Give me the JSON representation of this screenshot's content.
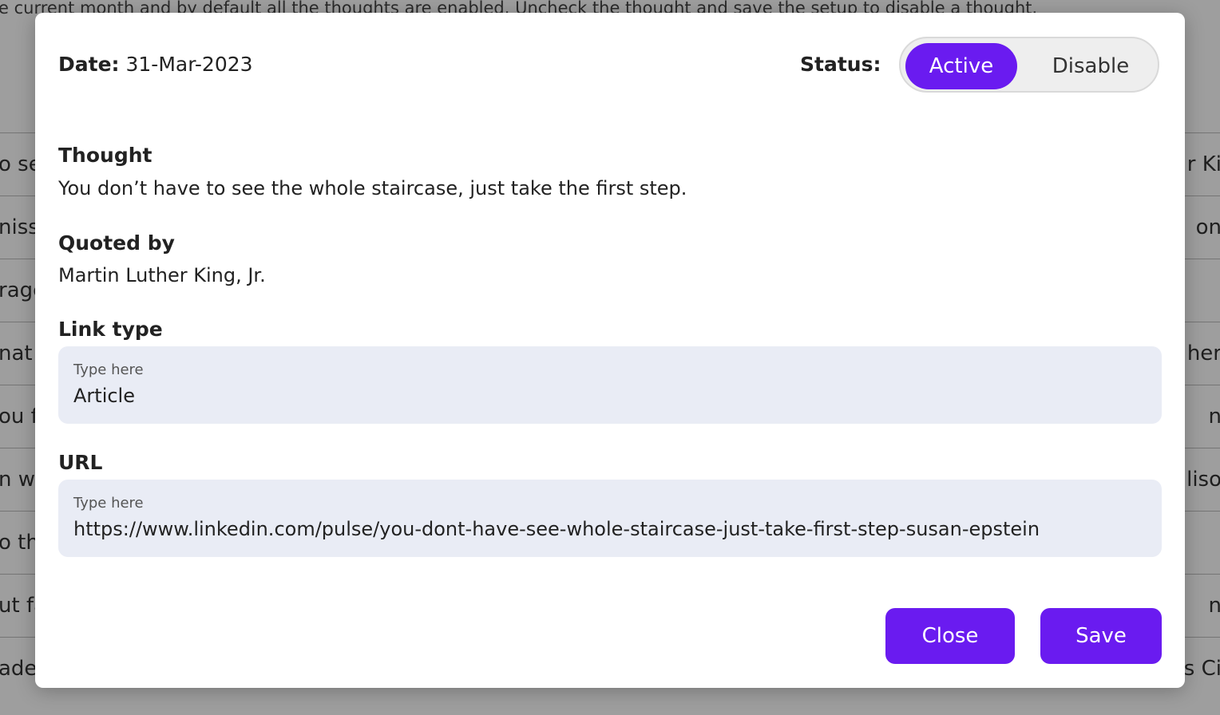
{
  "background": {
    "intro_text": "e current month and by default all the thoughts are enabled. Uncheck the thought and save the setup to disable a thought.",
    "rows": [
      {
        "left": "o se",
        "right": "r Ki"
      },
      {
        "left": "niss",
        "right": "on"
      },
      {
        "left": "rage",
        "right": ""
      },
      {
        "left": "nat l",
        "right": "her"
      },
      {
        "left": "ou f",
        "right": "n"
      },
      {
        "left": "n wa",
        "right": "liso"
      },
      {
        "left": "o th",
        "right": ""
      },
      {
        "left": "ut fa",
        "right": "n"
      },
      {
        "left": "ade",
        "right": "s Ci"
      }
    ]
  },
  "modal": {
    "date_label": "Date:",
    "date_value": "31-Mar-2023",
    "status_label": "Status:",
    "status_options": {
      "active": "Active",
      "disable": "Disable"
    },
    "status_selected": "Active",
    "thought_label": "Thought",
    "thought_value": "You don’t have to see the whole staircase, just take the first step.",
    "quoted_label": "Quoted by",
    "quoted_value": "Martin Luther King, Jr.",
    "link_type": {
      "label": "Link type",
      "placeholder": "Type here",
      "value": "Article"
    },
    "url": {
      "label": "URL",
      "placeholder": "Type here",
      "value": "https://www.linkedin.com/pulse/you-dont-have-see-whole-staircase-just-take-first-step-susan-epstein"
    },
    "close_label": "Close",
    "save_label": "Save"
  },
  "colors": {
    "accent": "#6a1bf0",
    "input_bg": "#e9ecf5"
  }
}
